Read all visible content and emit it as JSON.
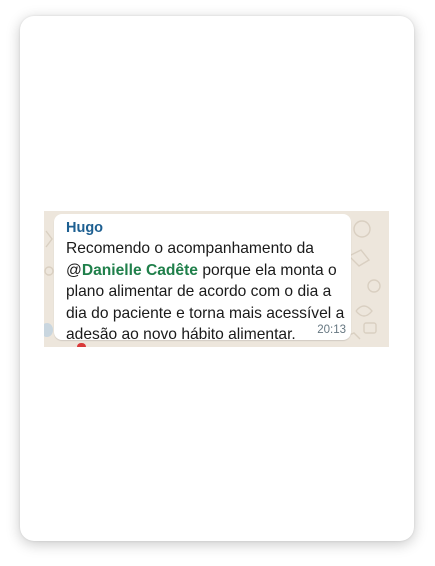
{
  "chat": {
    "sender_name": "Hugo",
    "message_before": "Recomendo o acompanhamento da @",
    "mention": "Danielle Cadête",
    "message_after": " porque ela monta o plano alimentar de acordo com o dia a dia do paciente e torna mais acessível a adesão ao novo hábito alimentar.",
    "time": "20:13"
  },
  "colors": {
    "sender": "#1d5f91",
    "mention": "#1f7f4a",
    "wallpaper": "#ede6dc",
    "bubble": "#ffffff"
  }
}
